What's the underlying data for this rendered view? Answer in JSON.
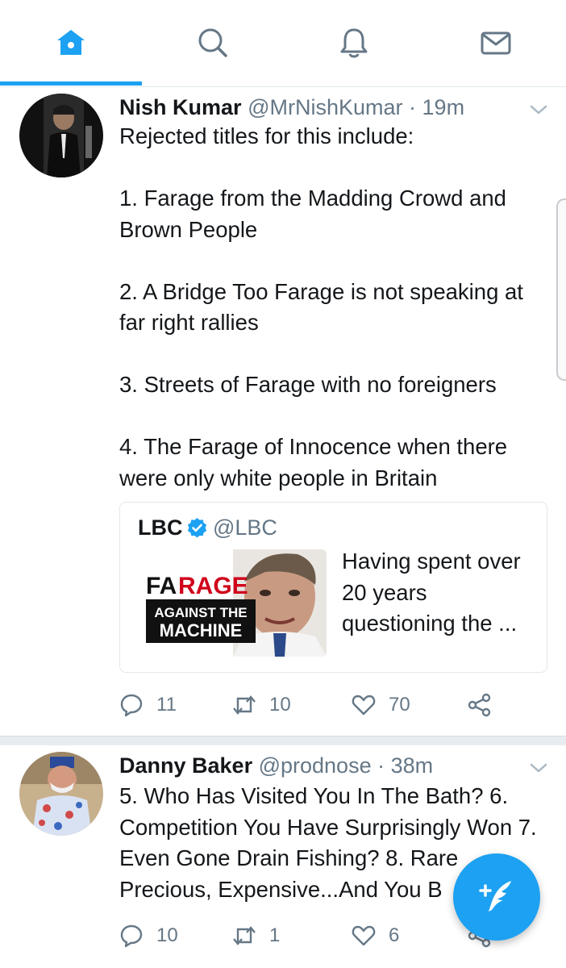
{
  "nav": {
    "tabs": [
      {
        "name": "home",
        "icon": "home-icon",
        "active": true
      },
      {
        "name": "search",
        "icon": "search-icon",
        "active": false
      },
      {
        "name": "notifications",
        "icon": "bell-icon",
        "active": false
      },
      {
        "name": "messages",
        "icon": "mail-icon",
        "active": false
      }
    ],
    "accent": "#1da1f2",
    "inactive_color": "#657786"
  },
  "tweets": [
    {
      "name": "Nish Kumar",
      "handle": "@MrNishKumar",
      "separator": "·",
      "time": "19m",
      "text": "Rejected titles for this include:\n\n1. Farage from the Madding Crowd and Brown People\n\n2. A Bridge Too Farage is not speaking at far right rallies\n\n3. Streets of Farage with no foreigners\n\n4. The Farage of Innocence when there were only white people in Britain",
      "quote": {
        "name": "LBC",
        "handle": "@LBC",
        "verified": true,
        "text": "Having spent over 20 years questioning the ...",
        "thumbnail_text": {
          "line1a": "FA",
          "line1b": "RAGE",
          "line2": "AGAINST THE",
          "line3": "MACHINE"
        }
      },
      "replies": "11",
      "retweets": "10",
      "likes": "70"
    },
    {
      "name": "Danny Baker",
      "handle": "@prodnose",
      "separator": "·",
      "time": "38m",
      "text": "5. Who Has Visited You In The Bath? 6. Competition You Have Surprisingly Won 7. Even Gone Drain Fishing? 8. Rare Precious, Expensive...And You B",
      "replies": "10",
      "retweets": "1",
      "likes": "6"
    }
  ],
  "compose_button": {
    "icon": "compose-quill-icon"
  }
}
